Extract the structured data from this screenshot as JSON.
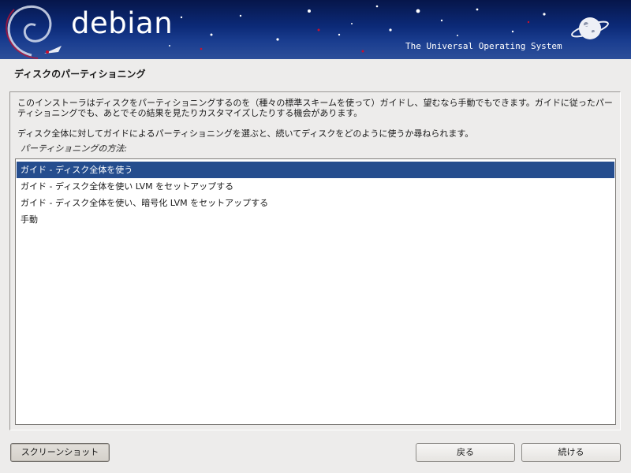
{
  "header": {
    "brand": "debian",
    "tagline": "The Universal Operating System"
  },
  "page": {
    "title": "ディスクのパーティショニング",
    "description_1": "このインストーラはディスクをパーティショニングするのを（種々の標準スキームを使って）ガイドし、望むなら手動でもできます。ガイドに従ったパーティショニングでも、あとでその結果を見たりカスタマイズしたりする機会があります。",
    "description_2": "ディスク全体に対してガイドによるパーティショニングを選ぶと、続いてディスクをどのように使うか尋ねられます。",
    "list_label": "パーティショニングの方法:",
    "options": [
      {
        "label": "ガイド - ディスク全体を使う",
        "selected": true
      },
      {
        "label": "ガイド - ディスク全体を使い LVM をセットアップする",
        "selected": false
      },
      {
        "label": "ガイド - ディスク全体を使い、暗号化 LVM をセットアップする",
        "selected": false
      },
      {
        "label": "手動",
        "selected": false
      }
    ]
  },
  "buttons": {
    "screenshot": "スクリーンショット",
    "back": "戻る",
    "continue": "続ける"
  },
  "colors": {
    "selection": "#254d8e",
    "banner": "#0c2a78",
    "swirl": "#c8102e"
  }
}
